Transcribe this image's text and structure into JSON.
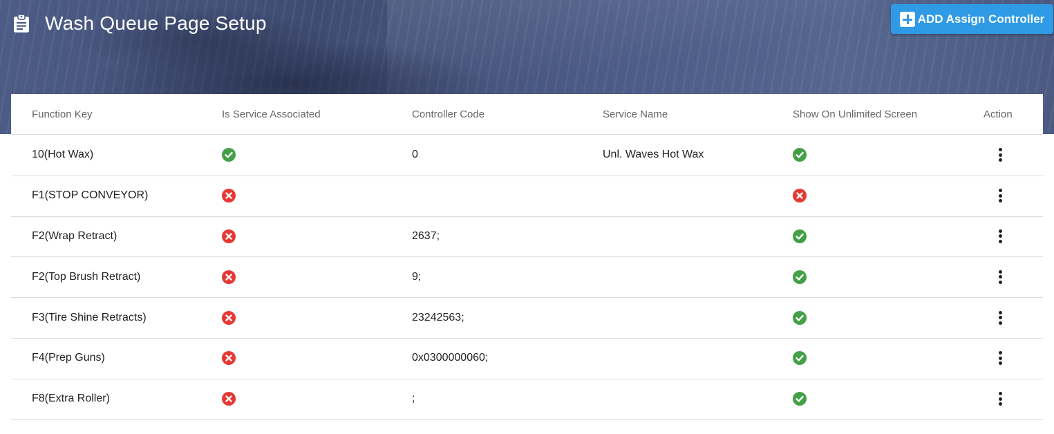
{
  "header": {
    "title": "Wash Queue Page Setup",
    "title_icon": "clipboard-icon",
    "add_button_label": "ADD Assign Controller",
    "add_button_icon": "plus-square-icon"
  },
  "colors": {
    "accent": "#2f9ae6",
    "success": "#43a047",
    "error": "#e53935",
    "hero": "#4b5a85"
  },
  "table": {
    "columns": [
      "Function Key",
      "Is Service Associated",
      "Controller Code",
      "Service Name",
      "Show On Unlimited Screen",
      "Action"
    ],
    "rows": [
      {
        "function_key": "10(Hot Wax)",
        "service_associated": true,
        "controller_code": "0",
        "service_name": "Unl. Waves Hot Wax",
        "show_unlimited": true
      },
      {
        "function_key": "F1(STOP CONVEYOR)",
        "service_associated": false,
        "controller_code": "",
        "service_name": "",
        "show_unlimited": false
      },
      {
        "function_key": "F2(Wrap Retract)",
        "service_associated": false,
        "controller_code": "2637;",
        "service_name": "",
        "show_unlimited": true
      },
      {
        "function_key": "F2(Top Brush Retract)",
        "service_associated": false,
        "controller_code": "9;",
        "service_name": "",
        "show_unlimited": true
      },
      {
        "function_key": "F3(Tire Shine Retracts)",
        "service_associated": false,
        "controller_code": "23242563;",
        "service_name": "",
        "show_unlimited": true
      },
      {
        "function_key": "F4(Prep Guns)",
        "service_associated": false,
        "controller_code": "0x0300000060;",
        "service_name": "",
        "show_unlimited": true
      },
      {
        "function_key": "F8(Extra Roller)",
        "service_associated": false,
        "controller_code": ";",
        "service_name": "",
        "show_unlimited": true
      }
    ]
  }
}
